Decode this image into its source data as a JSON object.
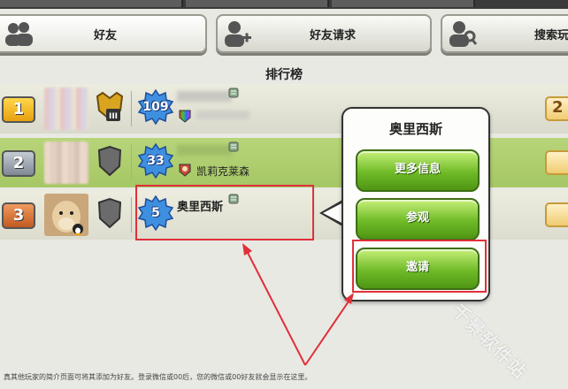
{
  "tabs": [
    {
      "label": "好友",
      "icon": "friends-icon"
    },
    {
      "label": "好友请求",
      "icon": "add-friend-icon"
    },
    {
      "label": "搜索玩",
      "icon": "search-player-icon"
    }
  ],
  "leaderboard_title": "排行榜",
  "rows": [
    {
      "rank": "1",
      "level": "109",
      "name": "",
      "clan": "",
      "rank_color": "#f0b71e"
    },
    {
      "rank": "2",
      "level": "33",
      "name": "",
      "clan": "凯莉克莱森",
      "rank_color": "#9aa3ad"
    },
    {
      "rank": "3",
      "level": "5",
      "name": "奥里西斯",
      "clan": "",
      "rank_color": "#d9773a"
    }
  ],
  "right_badges": [
    "2",
    "",
    ""
  ],
  "popup": {
    "title": "奥里西斯",
    "buttons": [
      "更多信息",
      "参观",
      "邀请"
    ]
  },
  "footer_text": "真其他玩家的简介页面可将其添加为好友。登录微信或00后，您的微信或00好友就会显示在这里。",
  "watermark": "千景软件站",
  "colors": {
    "highlight_row": "#b0cf70",
    "annotation": "#e0303a",
    "button_green": "#6fba27"
  }
}
